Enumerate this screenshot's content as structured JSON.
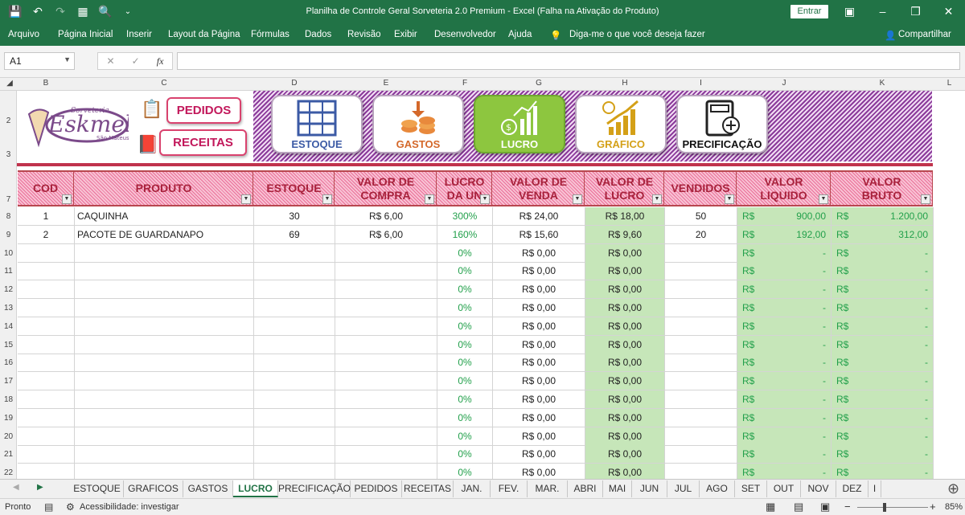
{
  "window": {
    "title": "Planilha de Controle Geral Sorveteria 2.0 Premium  -  Excel (Falha na Ativação do Produto)",
    "signin": "Entrar"
  },
  "menu": [
    "Arquivo",
    "Página Inicial",
    "Inserir",
    "Layout da Página",
    "Fórmulas",
    "Dados",
    "Revisão",
    "Exibir",
    "Desenvolvedor",
    "Ajuda"
  ],
  "tellme": "Diga-me o que você deseja fazer",
  "share": "Compartilhar",
  "namebox": "A1",
  "fx": "fx",
  "columns": [
    "A",
    "B",
    "C",
    "D",
    "E",
    "F",
    "G",
    "H",
    "I",
    "J",
    "K",
    "L"
  ],
  "logo": {
    "line1": "Sorveteria",
    "line2": "Eskmel",
    "line3": "São Mateus"
  },
  "buttons": {
    "pedidos": "PEDIDOS",
    "receitas": "RECEITAS",
    "estoque": "ESTOQUE",
    "gastos": "GASTOS",
    "lucro": "LUCRO",
    "grafico": "GRÁFICO",
    "precificacao": "PRECIFICAÇÃO"
  },
  "headers": [
    [
      "COD",
      ""
    ],
    [
      "PRODUTO",
      ""
    ],
    [
      "ESTOQUE",
      ""
    ],
    [
      "VALOR DE",
      "COMPRA"
    ],
    [
      "LUCRO",
      "DA UN"
    ],
    [
      "VALOR DE",
      "VENDA"
    ],
    [
      "VALOR DE",
      "LUCRO"
    ],
    [
      "VENDIDOS",
      ""
    ],
    [
      "VALOR",
      "LIQUIDO"
    ],
    [
      "VALOR",
      "BRUTO"
    ]
  ],
  "row_numbers": [
    "2",
    "3",
    "7",
    "8",
    "9",
    "10",
    "11",
    "12",
    "13",
    "14",
    "15",
    "16",
    "17",
    "18",
    "19",
    "20",
    "21",
    "22"
  ],
  "rows": [
    [
      "1",
      "CAQUINHA",
      "30",
      "R$ 6,00",
      "300%",
      "R$ 24,00",
      "R$ 18,00",
      "50",
      "R$",
      "900,00",
      "R$",
      "1.200,00"
    ],
    [
      "2",
      "PACOTE DE GUARDANAPO",
      "69",
      "R$ 6,00",
      "160%",
      "R$ 15,60",
      "R$ 9,60",
      "20",
      "R$",
      "192,00",
      "R$",
      "312,00"
    ],
    [
      "",
      "",
      "",
      "",
      "0%",
      "R$ 0,00",
      "R$ 0,00",
      "",
      "R$",
      "-",
      "R$",
      "-"
    ],
    [
      "",
      "",
      "",
      "",
      "0%",
      "R$ 0,00",
      "R$ 0,00",
      "",
      "R$",
      "-",
      "R$",
      "-"
    ],
    [
      "",
      "",
      "",
      "",
      "0%",
      "R$ 0,00",
      "R$ 0,00",
      "",
      "R$",
      "-",
      "R$",
      "-"
    ],
    [
      "",
      "",
      "",
      "",
      "0%",
      "R$ 0,00",
      "R$ 0,00",
      "",
      "R$",
      "-",
      "R$",
      "-"
    ],
    [
      "",
      "",
      "",
      "",
      "0%",
      "R$ 0,00",
      "R$ 0,00",
      "",
      "R$",
      "-",
      "R$",
      "-"
    ],
    [
      "",
      "",
      "",
      "",
      "0%",
      "R$ 0,00",
      "R$ 0,00",
      "",
      "R$",
      "-",
      "R$",
      "-"
    ],
    [
      "",
      "",
      "",
      "",
      "0%",
      "R$ 0,00",
      "R$ 0,00",
      "",
      "R$",
      "-",
      "R$",
      "-"
    ],
    [
      "",
      "",
      "",
      "",
      "0%",
      "R$ 0,00",
      "R$ 0,00",
      "",
      "R$",
      "-",
      "R$",
      "-"
    ],
    [
      "",
      "",
      "",
      "",
      "0%",
      "R$ 0,00",
      "R$ 0,00",
      "",
      "R$",
      "-",
      "R$",
      "-"
    ],
    [
      "",
      "",
      "",
      "",
      "0%",
      "R$ 0,00",
      "R$ 0,00",
      "",
      "R$",
      "-",
      "R$",
      "-"
    ],
    [
      "",
      "",
      "",
      "",
      "0%",
      "R$ 0,00",
      "R$ 0,00",
      "",
      "R$",
      "-",
      "R$",
      "-"
    ],
    [
      "",
      "",
      "",
      "",
      "0%",
      "R$ 0,00",
      "R$ 0,00",
      "",
      "R$",
      "-",
      "R$",
      "-"
    ],
    [
      "",
      "",
      "",
      "",
      "0%",
      "R$ 0,00",
      "R$ 0,00",
      "",
      "R$",
      "-",
      "R$",
      "-"
    ]
  ],
  "tabs": [
    "ESTOQUE",
    "GRAFICOS",
    "GASTOS",
    "LUCRO",
    "PRECIFICAÇÃO",
    "PEDIDOS",
    "RECEITAS",
    "JAN.",
    "FEV.",
    "MAR.",
    "ABRI",
    "MAI",
    "JUN",
    "JUL",
    "AGO",
    "SET",
    "OUT",
    "NOV",
    "DEZ",
    "I"
  ],
  "active_tab": "LUCRO",
  "status": {
    "ready": "Pronto",
    "accessibility": "Acessibilidade: investigar",
    "zoom": "85%"
  },
  "colors": {
    "excel_green": "#217346",
    "header_pink": "#f8c2d4",
    "header_text": "#a8223c",
    "lucro_fill": "#c6e6b9",
    "percent_green": "#22a04b",
    "stripes": "#8b3b9b"
  }
}
